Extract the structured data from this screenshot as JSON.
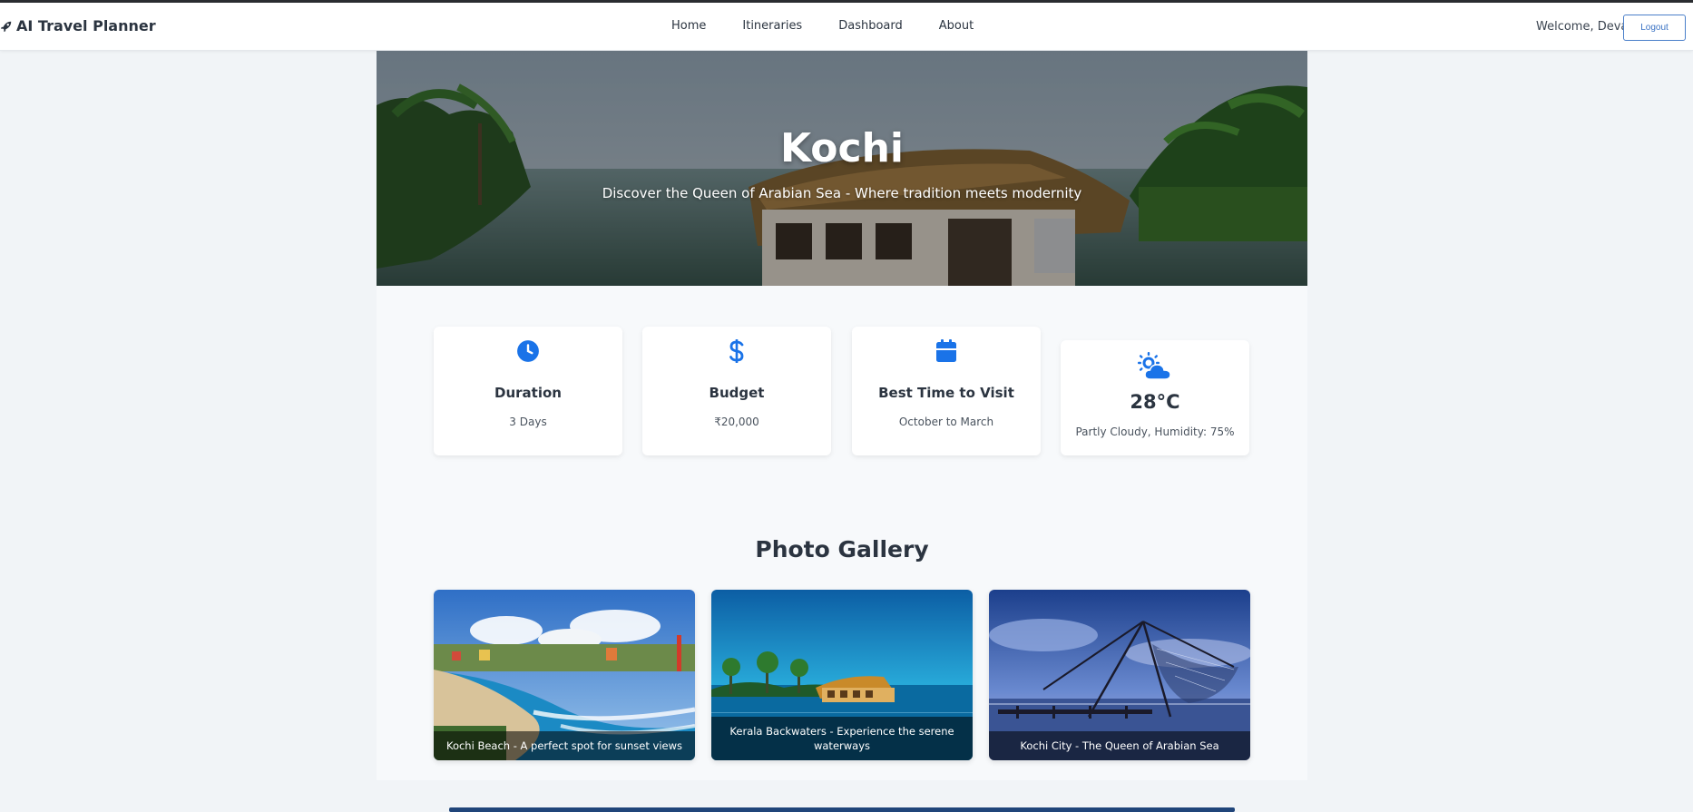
{
  "navbar": {
    "brand": "AI Travel Planner",
    "links": [
      "Home",
      "Itineraries",
      "Dashboard",
      "About"
    ],
    "welcome": "Welcome, Deva",
    "logout": "Logout"
  },
  "hero": {
    "title": "Kochi",
    "subtitle": "Discover the Queen of Arabian Sea - Where tradition meets modernity"
  },
  "info_cards": {
    "duration": {
      "icon": "clock-icon",
      "title": "Duration",
      "value": "3 Days"
    },
    "budget": {
      "icon": "dollar-icon",
      "title": "Budget",
      "value": "₹20,000"
    },
    "best_time": {
      "icon": "calendar-icon",
      "title": "Best Time to Visit",
      "value": "October to March"
    },
    "weather": {
      "icon": "partly-cloudy-icon",
      "temperature": "28°C",
      "value": "Partly Cloudy, Humidity: 75%"
    }
  },
  "gallery": {
    "title": "Photo Gallery",
    "photos": [
      {
        "caption": "Kochi Beach - A perfect spot for sunset views"
      },
      {
        "caption": "Kerala Backwaters - Experience the serene waterways"
      },
      {
        "caption": "Kochi City - The Queen of Arabian Sea"
      }
    ]
  },
  "colors": {
    "accent": "#1a73e8",
    "text": "#2b3440",
    "page_bg": "#f1f4f7"
  }
}
